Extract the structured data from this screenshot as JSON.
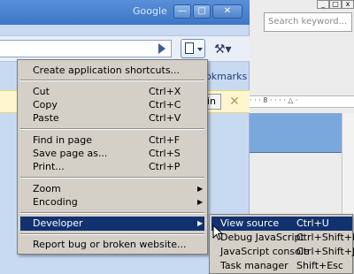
{
  "window": {
    "brand": "Google",
    "minimize_glyph": "—",
    "maximize_glyph": "□",
    "close_glyph": "✕"
  },
  "toolbar": {
    "go_icon": "play-arrow-icon",
    "page_icon": "page-menu-icon",
    "wrench_icon": "wrench-menu-icon",
    "wrench_glyph": "⚒▾"
  },
  "bookmarks": {
    "label": "okmarks"
  },
  "infobar": {
    "button_label": "in",
    "close_glyph": "✕"
  },
  "right_app": {
    "search_placeholder": "Search keyword...",
    "ruler_marks": "· · · 8 · · · · △ ·"
  },
  "menu": {
    "items": [
      {
        "label": "Create application shortcuts...",
        "shortcut": ""
      },
      {
        "label": "Cut",
        "shortcut": "Ctrl+X"
      },
      {
        "label": "Copy",
        "shortcut": "Ctrl+C"
      },
      {
        "label": "Paste",
        "shortcut": "Ctrl+V"
      },
      {
        "label": "Find in page",
        "shortcut": "Ctrl+F"
      },
      {
        "label": "Save page as...",
        "shortcut": "Ctrl+S"
      },
      {
        "label": "Print...",
        "shortcut": "Ctrl+P"
      },
      {
        "label": "Zoom",
        "shortcut": "",
        "submenu": "▶"
      },
      {
        "label": "Encoding",
        "shortcut": "",
        "submenu": "▶"
      },
      {
        "label": "Developer",
        "shortcut": "",
        "submenu": "▶"
      },
      {
        "label": "Report bug or broken website...",
        "shortcut": ""
      }
    ]
  },
  "submenu": {
    "items": [
      {
        "label": "View source",
        "shortcut": "Ctrl+U"
      },
      {
        "label": "Debug JavaScript",
        "shortcut": "Ctrl+Shift+L"
      },
      {
        "label": "JavaScript console",
        "shortcut": "Ctrl+Shift+J"
      },
      {
        "label": "Task manager",
        "shortcut": "Shift+Esc"
      }
    ]
  },
  "colors": {
    "highlight": "#12326f",
    "menu_bg": "#d4d0c8",
    "titlebar": "#3e76c8"
  }
}
